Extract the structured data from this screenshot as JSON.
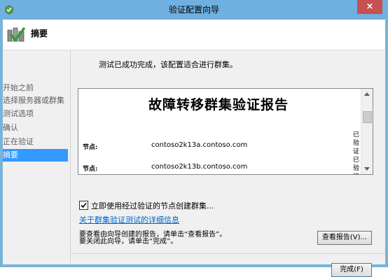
{
  "window": {
    "title": "验证配置向导",
    "close_label": "×"
  },
  "header": {
    "title": "摘要"
  },
  "nav": {
    "items": [
      {
        "label": "开始之前"
      },
      {
        "label": "选择服务器或群集"
      },
      {
        "label": "测试选项"
      },
      {
        "label": "确认"
      },
      {
        "label": "正在验证"
      },
      {
        "label": "摘要"
      }
    ],
    "active_index": 5
  },
  "main": {
    "message": "测试已成功完成，该配置适合进行群集。",
    "report": {
      "title": "故障转移群集验证报告",
      "nodes": [
        {
          "label": "节点:",
          "value": "contoso2k13a.contoso.com",
          "side": "已验证"
        },
        {
          "label": "节点:",
          "value": "contoso2k13b.contoso.com",
          "side": "已验证"
        }
      ]
    },
    "checkbox": {
      "label": "立即使用经过验证的节点创建群集...",
      "checked": true
    },
    "link": "关于群集验证测试的详细信息",
    "instructions": [
      "要查看由向导创建的报告，请单击“查看报告”。",
      "要关闭此向导，请单击“完成”。"
    ],
    "view_report_button": "查看报告(V)...",
    "finish_button": "完成(F)"
  },
  "colors": {
    "titlebar": "#6fb0e0",
    "close": "#c75050",
    "nav_active": "#3399ff",
    "link": "#0066cc"
  }
}
